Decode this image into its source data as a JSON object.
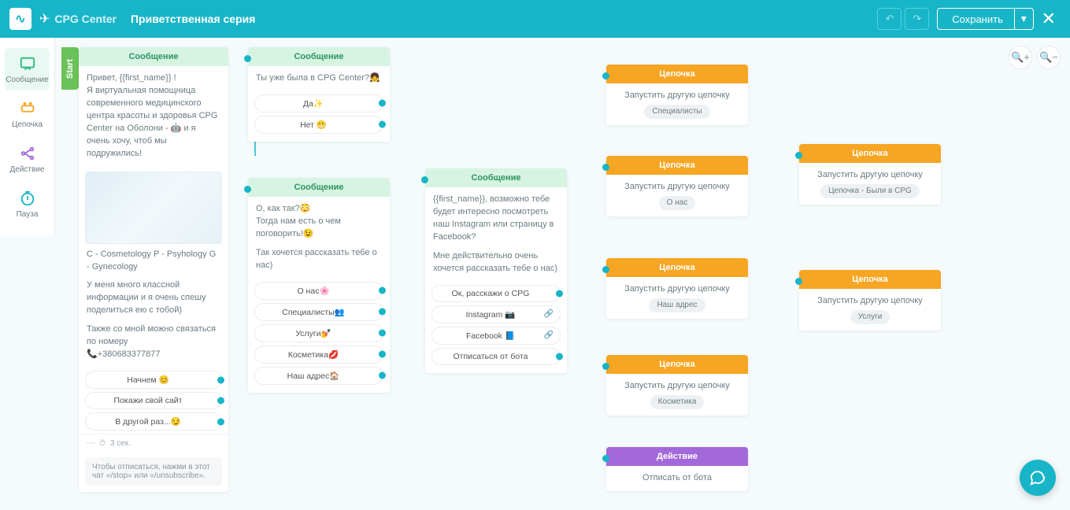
{
  "header": {
    "app": "CPG Center",
    "subtitle": "Приветственная серия",
    "save": "Сохранить"
  },
  "sidebar": {
    "items": [
      {
        "label": "Сообщение"
      },
      {
        "label": "Цепочка"
      },
      {
        "label": "Действие"
      },
      {
        "label": "Пауза"
      }
    ]
  },
  "start_label": "Start",
  "node1": {
    "header": "Сообщение",
    "text1": "Привет, {{first_name}} !\nЯ виртуальная помощница современного медицинского центра красоты и здоровья CPG Center на Оболони - 🤖 и я очень хочу, чтоб мы подружились!",
    "text2": "C - Cosmetology\nP - Psyhology\nG - Gynecology",
    "text3": "У меня много классной информации и я очень спешу поделиться ею с тобой)",
    "text4": "Также со мной можно связаться по номеру\n📞+380683377877",
    "opts": [
      "Начнем 😊",
      "Покажи свой сайт",
      "В другой раз...😏"
    ],
    "footer_time": "3 сек.",
    "note": "Чтобы отписаться, нажми в этот чат «/stop» или «/unsubscribe»."
  },
  "node2": {
    "header": "Сообщение",
    "text": "Ты уже была в CPG Center?👧",
    "opts": [
      "Да✨",
      "Нет 😬"
    ]
  },
  "node3": {
    "header": "Сообщение",
    "text1": "О, как так?😳\nТогда нам есть о чем поговорить!😉",
    "text2": "Так хочется рассказать тебе о нас)",
    "opts": [
      "О нас🌸",
      "Специалисты👥",
      "Услуги💅",
      "Косметика💋",
      "Наш адрес🏠"
    ]
  },
  "node4": {
    "header": "Сообщение",
    "text1": "{{first_name}}, возможно тебе будет интересно посмотреть наш Instagram или страницу в Facebook?",
    "text2": "Мне действительно очень хочется рассказать тебе о нас)",
    "opts": [
      {
        "label": "Ок, расскажи о CPG",
        "link": false
      },
      {
        "label": "Instagram 📷",
        "link": true
      },
      {
        "label": "Facebook 📘",
        "link": true
      },
      {
        "label": "Отписаться от бота",
        "link": false
      }
    ]
  },
  "chains": {
    "run_label": "Запустить другую цепочку",
    "c1": {
      "header": "Цепочка",
      "tag": "Специалисты"
    },
    "c2": {
      "header": "Цепочка",
      "tag": "О нас"
    },
    "c3": {
      "header": "Цепочка",
      "tag": "Наш адрес"
    },
    "c4": {
      "header": "Цепочка",
      "tag": "Косметика"
    },
    "c5": {
      "header": "Цепочка",
      "tag": "Цепочка - Были в CPG"
    },
    "c6": {
      "header": "Цепочка",
      "tag": "Услуги"
    }
  },
  "action": {
    "header": "Действие",
    "label": "Отписать от бота"
  }
}
